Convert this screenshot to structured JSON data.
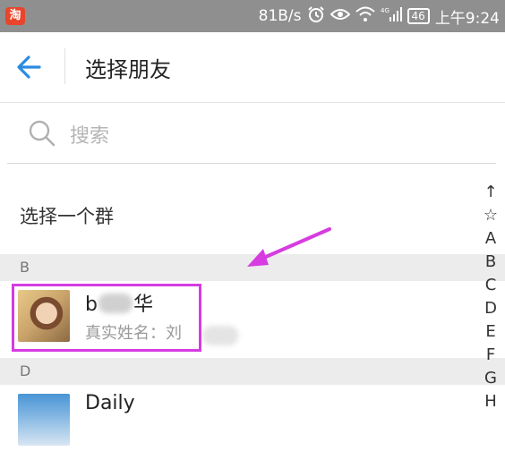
{
  "status_bar": {
    "app_icon_text": "淘",
    "speed": "81B/s",
    "network": "4G",
    "battery": "46",
    "time": "上午9:24"
  },
  "header": {
    "back_icon": "arrow-left-icon",
    "title": "选择朋友",
    "accent_color": "#2a8ce0"
  },
  "search": {
    "icon": "search-icon",
    "placeholder": "搜索"
  },
  "select_group": {
    "label": "选择一个群"
  },
  "sections": [
    {
      "letter": "B",
      "contacts": [
        {
          "name_prefix": "b",
          "name_suffix": "华",
          "sub_label": "真实姓名：刘"
        }
      ]
    },
    {
      "letter": "D",
      "contacts": [
        {
          "name": "Daily"
        }
      ]
    }
  ],
  "index_bar": [
    "↑",
    "☆",
    "A",
    "B",
    "C",
    "D",
    "E",
    "F",
    "G",
    "H"
  ],
  "annotation": {
    "highlight_color": "#d63ce0"
  }
}
